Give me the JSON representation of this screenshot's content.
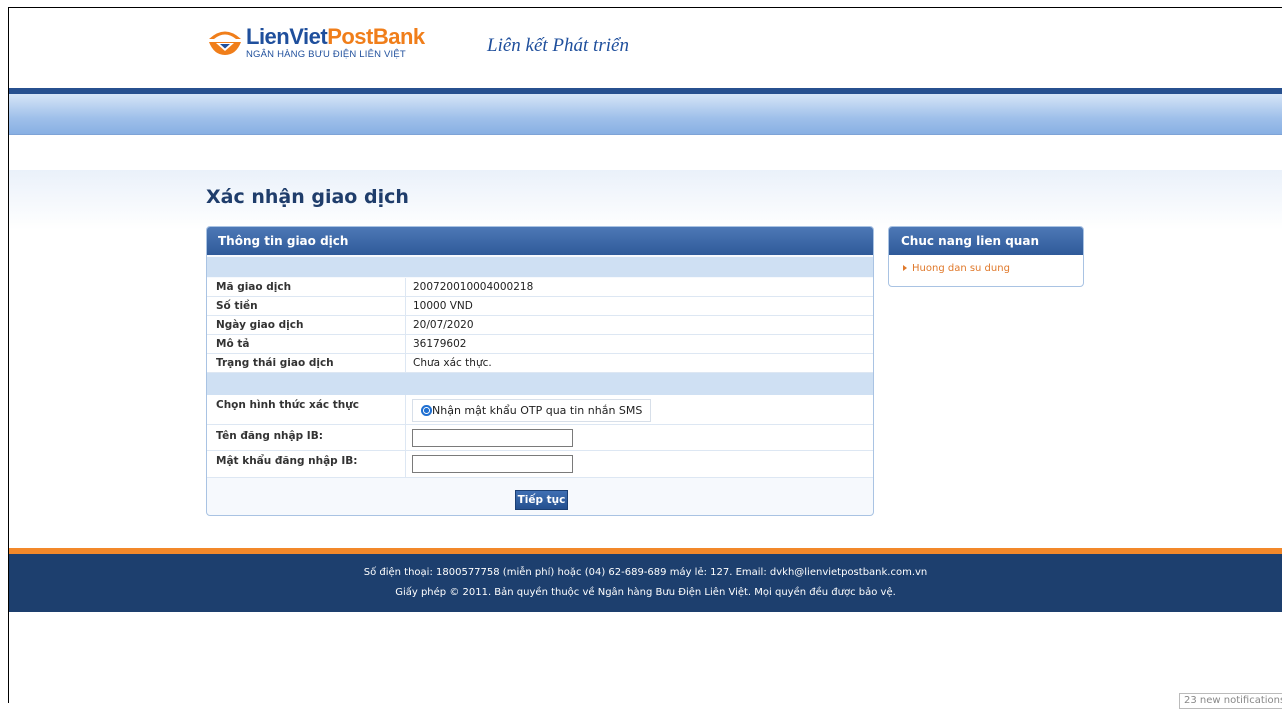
{
  "brand": {
    "name_part1": "LienViet",
    "name_part2": "PostBank",
    "subtitle": "NGÂN HÀNG BƯU ĐIỆN LIÊN VIỆT",
    "slogan": "Liên kết Phát triển"
  },
  "page_title": "Xác nhận giao dịch",
  "main_panel": {
    "title": "Thông tin giao dịch",
    "rows": [
      {
        "label": "Mã giao dịch",
        "value": "200720010004000218"
      },
      {
        "label": "Số tiền",
        "value": "10000   VND"
      },
      {
        "label": "Ngày giao dịch",
        "value": "20/07/2020"
      },
      {
        "label": "Mô tả",
        "value": "36179602"
      },
      {
        "label": "Trạng thái giao dịch",
        "value": "Chưa xác thực."
      }
    ],
    "auth_method_label": "Chọn hình thức xác thực",
    "auth_option_label": "Nhận mật khẩu OTP qua tin nhắn SMS",
    "username_label": "Tên đăng nhập IB:",
    "username_value": "",
    "password_label": "Mật khẩu đăng nhập IB:",
    "password_value": "",
    "continue_button": "Tiếp tục"
  },
  "side_panel": {
    "title": "Chuc nang lien quan",
    "links": [
      "Huong dan su dung"
    ]
  },
  "footer": {
    "line1": "Số điện thoại: 1800577758 (miễn phí) hoặc (04) 62-689-689 máy lẻ: 127. Email: dvkh@lienvietpostbank.com.vn",
    "line2": "Giấy phép © 2011. Bản quyền thuộc về Ngân hàng Bưu Điện Liên Việt. Mọi quyền đều được bảo vệ."
  },
  "notification": "23 new notifications",
  "colors": {
    "brand_blue": "#1f4f9c",
    "brand_orange": "#f07e1a",
    "footer_bg": "#1d3f6e",
    "link_orange": "#e0792b"
  }
}
